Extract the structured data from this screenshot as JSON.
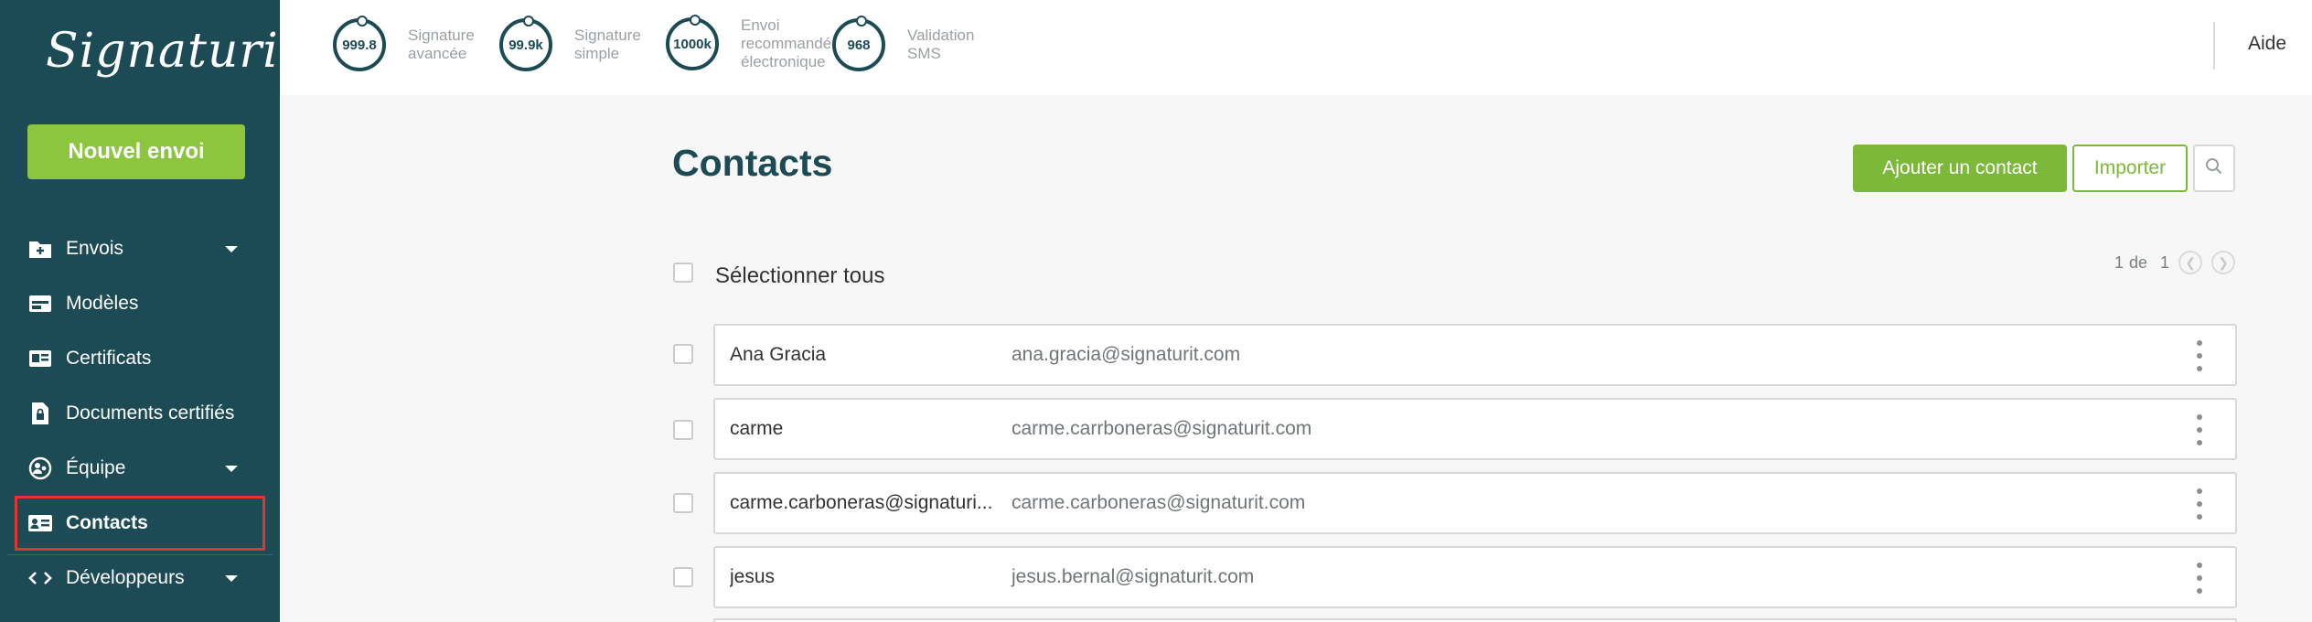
{
  "brand": {
    "logo_text": "Signaturit"
  },
  "sidebar": {
    "new_button": "Nouvel envoi",
    "items": [
      {
        "label": "Envois",
        "icon": "folder-plus-icon",
        "has_caret": true
      },
      {
        "label": "Modèles",
        "icon": "template-icon",
        "has_caret": false
      },
      {
        "label": "Certificats",
        "icon": "certificate-icon",
        "has_caret": false
      },
      {
        "label": "Documents certifiés",
        "icon": "locked-document-icon",
        "has_caret": false
      },
      {
        "label": "Équipe",
        "icon": "team-icon",
        "has_caret": true
      },
      {
        "label": "Contacts",
        "icon": "contact-card-icon",
        "has_caret": false,
        "active": true
      },
      {
        "label": "Développeurs",
        "icon": "code-icon",
        "has_caret": true
      }
    ]
  },
  "topbar": {
    "counters": [
      {
        "value": "999.8",
        "label": "Signature avancée"
      },
      {
        "value": "99.9k",
        "label": "Signature simple"
      },
      {
        "value": "1000k",
        "label": "Envoi recommandé électronique"
      },
      {
        "value": "968",
        "label": "Validation SMS"
      }
    ],
    "help_label": "Aide"
  },
  "main": {
    "title": "Contacts",
    "add_button": "Ajouter un contact",
    "import_button": "Importer",
    "select_all_label": "Sélectionner tous",
    "pager": {
      "current": "1",
      "of_label": "de",
      "total": "1"
    },
    "contacts": [
      {
        "name": "Ana Gracia",
        "email": "ana.gracia@signaturit.com"
      },
      {
        "name": "carme",
        "email": "carme.carrboneras@signaturit.com"
      },
      {
        "name": "carme.carboneras@signaturi...",
        "email": "carme.carboneras@signaturit.com"
      },
      {
        "name": "jesus",
        "email": "jesus.bernal@signaturit.com"
      }
    ]
  },
  "colors": {
    "sidebar_bg": "#1c4a55",
    "accent_green": "#8cc63f",
    "button_green": "#7cb839",
    "active_outline": "#e0362b"
  }
}
